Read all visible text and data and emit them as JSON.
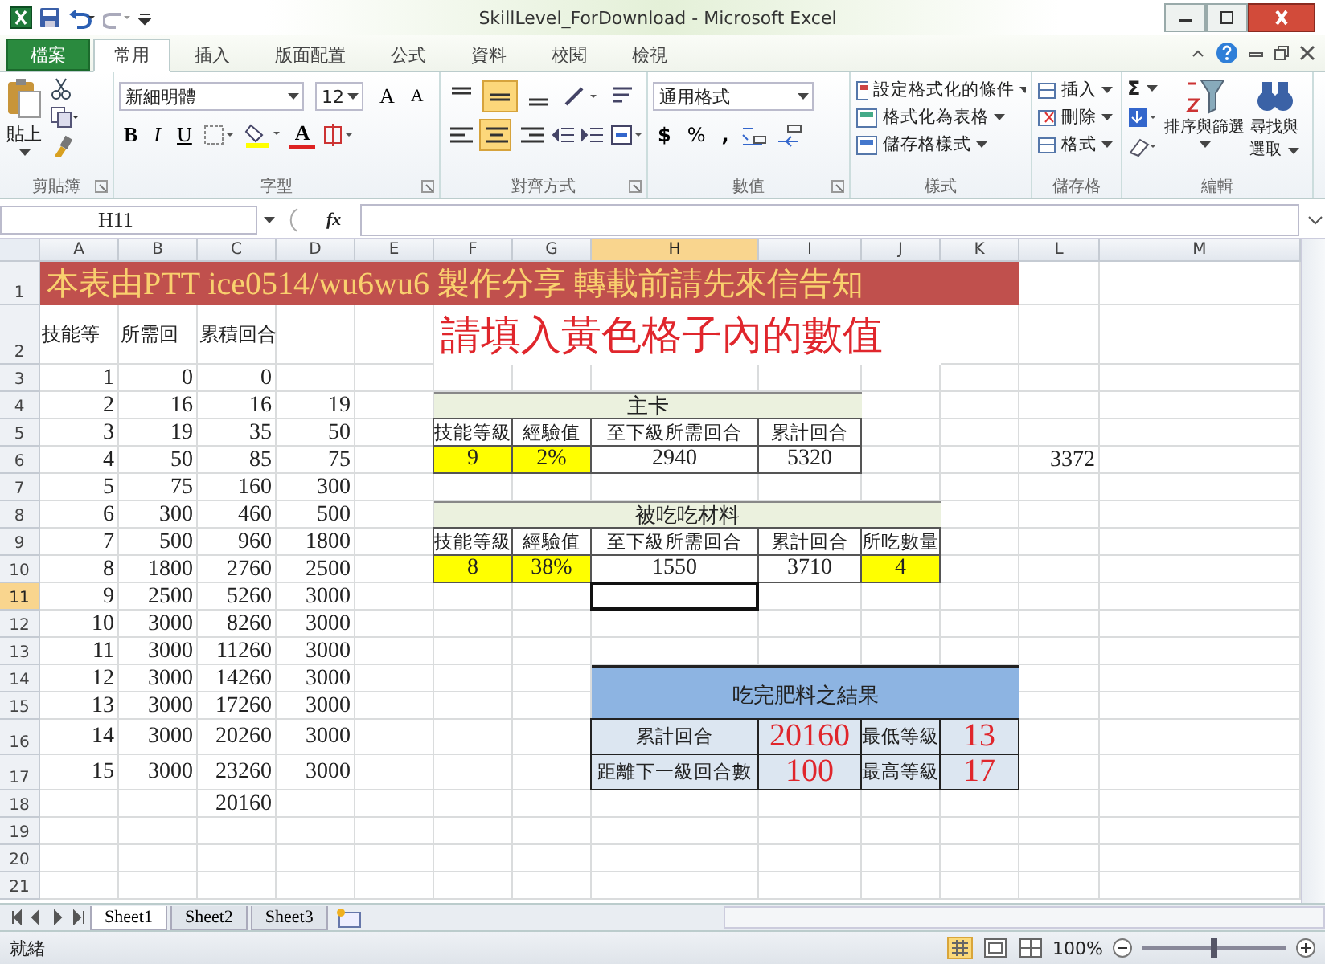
{
  "window": {
    "title": "SkillLevel_ForDownload - Microsoft Excel"
  },
  "tabs": [
    {
      "label": "檔案",
      "kind": "file",
      "selected": false
    },
    {
      "label": "常用",
      "kind": "tab",
      "selected": true
    },
    {
      "label": "插入",
      "kind": "tab",
      "selected": false
    },
    {
      "label": "版面配置",
      "kind": "tab",
      "selected": false
    },
    {
      "label": "公式",
      "kind": "tab",
      "selected": false
    },
    {
      "label": "資料",
      "kind": "tab",
      "selected": false
    },
    {
      "label": "校閱",
      "kind": "tab",
      "selected": false
    },
    {
      "label": "檢視",
      "kind": "tab",
      "selected": false
    }
  ],
  "ribbon": {
    "clipboard": {
      "label": "剪貼簿",
      "paste": "貼上"
    },
    "font": {
      "label": "字型",
      "font_name": "新細明體",
      "font_size": "12",
      "grow": "A",
      "shrink": "A",
      "bold": "B",
      "italic": "I",
      "underline": "U",
      "font_color": "A"
    },
    "alignment": {
      "label": "對齊方式",
      "vertical": [
        {
          "selected": false
        },
        {
          "selected": true
        },
        {
          "selected": false
        }
      ],
      "horizontal": [
        {
          "selected": false
        },
        {
          "selected": true
        },
        {
          "selected": false
        }
      ]
    },
    "number": {
      "label": "數值",
      "format": "通用格式",
      "currency": "$",
      "percent": "%",
      "comma": ","
    },
    "styles": {
      "label": "樣式",
      "items": [
        "設定格式化的條件",
        "格式化為表格",
        "儲存格樣式"
      ]
    },
    "cells": {
      "label": "儲存格",
      "items": [
        "插入",
        "刪除",
        "格式"
      ]
    },
    "editing": {
      "label": "編輯",
      "sum": "Σ",
      "sort": "排序與篩選",
      "find": "尋找與",
      "find_2": "選取"
    }
  },
  "formula_bar": {
    "name_box": "H11",
    "function_label": "fx"
  },
  "sheet": {
    "columns": [
      "A",
      "B",
      "C",
      "D",
      "E",
      "F",
      "G",
      "H",
      "I",
      "J",
      "K",
      "L",
      "M"
    ],
    "rows": [
      {
        "number": "1",
        "cells": [
          {
            "text": "本表由PTT ice0514/wu6wu6 製作分享 轉載前請先來信告知",
            "kind": "banner"
          },
          null,
          null,
          null,
          null,
          null,
          null,
          null,
          null,
          null,
          null
        ]
      },
      {
        "number": "2",
        "cells": [
          {
            "text": "技能等",
            "kind": "label"
          },
          {
            "text": "所需回",
            "kind": "label"
          },
          {
            "text": "累積回合",
            "kind": "label"
          },
          {},
          {},
          {
            "text": "請填入黃色格子內的數值",
            "kind": "note"
          },
          null,
          null,
          null,
          null
        ]
      },
      {
        "number": "3",
        "cells": [
          {
            "text": "1",
            "kind": "num"
          },
          {
            "text": "0",
            "kind": "num"
          },
          {
            "text": "0",
            "kind": "num"
          }
        ]
      },
      {
        "number": "4",
        "cells": [
          {
            "text": "2",
            "kind": "num"
          },
          {
            "text": "16",
            "kind": "num"
          },
          {
            "text": "16",
            "kind": "num"
          },
          {
            "text": "19",
            "kind": "num"
          },
          {},
          {
            "text": "主卡",
            "kind": "section"
          },
          null,
          null,
          null
        ]
      },
      {
        "number": "5",
        "cells": [
          {
            "text": "3",
            "kind": "num"
          },
          {
            "text": "19",
            "kind": "num"
          },
          {
            "text": "35",
            "kind": "num"
          },
          {
            "text": "50",
            "kind": "num"
          },
          {},
          {
            "text": "技能等級",
            "kind": "header"
          },
          {
            "text": "經驗值",
            "kind": "header"
          },
          {
            "text": "至下級所需回合",
            "kind": "header"
          },
          {
            "text": "累計回合",
            "kind": "header"
          }
        ]
      },
      {
        "number": "6",
        "cells": [
          {
            "text": "4",
            "kind": "num"
          },
          {
            "text": "50",
            "kind": "num"
          },
          {
            "text": "85",
            "kind": "num"
          },
          {
            "text": "75",
            "kind": "num"
          },
          {},
          {
            "text": "9",
            "kind": "input"
          },
          {
            "text": "2%",
            "kind": "input"
          },
          {
            "text": "2940",
            "kind": "value"
          },
          {
            "text": "5320",
            "kind": "value"
          },
          {},
          {},
          {
            "text": "3372",
            "kind": "num"
          }
        ]
      },
      {
        "number": "7",
        "cells": [
          {
            "text": "5",
            "kind": "num"
          },
          {
            "text": "75",
            "kind": "num"
          },
          {
            "text": "160",
            "kind": "num"
          },
          {
            "text": "300",
            "kind": "num"
          }
        ]
      },
      {
        "number": "8",
        "cells": [
          {
            "text": "6",
            "kind": "num"
          },
          {
            "text": "300",
            "kind": "num"
          },
          {
            "text": "460",
            "kind": "num"
          },
          {
            "text": "500",
            "kind": "num"
          },
          {},
          {
            "text": "被吃吃材料",
            "kind": "section"
          },
          null,
          null,
          null,
          null
        ]
      },
      {
        "number": "9",
        "cells": [
          {
            "text": "7",
            "kind": "num"
          },
          {
            "text": "500",
            "kind": "num"
          },
          {
            "text": "960",
            "kind": "num"
          },
          {
            "text": "1800",
            "kind": "num"
          },
          {},
          {
            "text": "技能等級",
            "kind": "header"
          },
          {
            "text": "經驗值",
            "kind": "header"
          },
          {
            "text": "至下級所需回合",
            "kind": "header"
          },
          {
            "text": "累計回合",
            "kind": "header"
          },
          {
            "text": "所吃數量",
            "kind": "header"
          }
        ]
      },
      {
        "number": "10",
        "cells": [
          {
            "text": "8",
            "kind": "num"
          },
          {
            "text": "1800",
            "kind": "num"
          },
          {
            "text": "2760",
            "kind": "num"
          },
          {
            "text": "2500",
            "kind": "num"
          },
          {},
          {
            "text": "8",
            "kind": "input"
          },
          {
            "text": "38%",
            "kind": "input"
          },
          {
            "text": "1550",
            "kind": "value"
          },
          {
            "text": "3710",
            "kind": "value"
          },
          {
            "text": "4",
            "kind": "input"
          }
        ]
      },
      {
        "number": "11",
        "cells": [
          {
            "text": "9",
            "kind": "num"
          },
          {
            "text": "2500",
            "kind": "num"
          },
          {
            "text": "5260",
            "kind": "num"
          },
          {
            "text": "3000",
            "kind": "num"
          },
          {},
          {},
          {},
          {
            "selected": true
          }
        ]
      },
      {
        "number": "12",
        "cells": [
          {
            "text": "10",
            "kind": "num"
          },
          {
            "text": "3000",
            "kind": "num"
          },
          {
            "text": "8260",
            "kind": "num"
          },
          {
            "text": "3000",
            "kind": "num"
          }
        ]
      },
      {
        "number": "13",
        "cells": [
          {
            "text": "11",
            "kind": "num"
          },
          {
            "text": "3000",
            "kind": "num"
          },
          {
            "text": "11260",
            "kind": "num"
          },
          {
            "text": "3000",
            "kind": "num"
          }
        ]
      },
      {
        "number": "14",
        "cells": [
          {
            "text": "12",
            "kind": "num"
          },
          {
            "text": "3000",
            "kind": "num"
          },
          {
            "text": "14260",
            "kind": "num"
          },
          {
            "text": "3000",
            "kind": "num"
          }
        ]
      },
      {
        "number": "15",
        "cells": [
          {
            "text": "13",
            "kind": "num"
          },
          {
            "text": "3000",
            "kind": "num"
          },
          {
            "text": "17260",
            "kind": "num"
          },
          {
            "text": "3000",
            "kind": "num"
          },
          {},
          {},
          {},
          {
            "text": "吃完肥料之結果",
            "kind": "result-head"
          },
          null,
          null,
          null
        ]
      },
      {
        "number": "16",
        "cells": [
          {
            "text": "14",
            "kind": "num"
          },
          {
            "text": "3000",
            "kind": "num"
          },
          {
            "text": "20260",
            "kind": "num"
          },
          {
            "text": "3000",
            "kind": "num"
          },
          {},
          {},
          {},
          {
            "text": "累計回合",
            "kind": "result-label"
          },
          {
            "text": "20160",
            "kind": "result-value"
          },
          {
            "text": "最低等級",
            "kind": "result-label"
          },
          {
            "text": "13",
            "kind": "result-value"
          }
        ]
      },
      {
        "number": "17",
        "cells": [
          {
            "text": "15",
            "kind": "num"
          },
          {
            "text": "3000",
            "kind": "num"
          },
          {
            "text": "23260",
            "kind": "num"
          },
          {
            "text": "3000",
            "kind": "num"
          },
          {},
          {},
          {},
          {
            "text": "距離下一級回合數",
            "kind": "result-label"
          },
          {
            "text": "100",
            "kind": "result-value"
          },
          {
            "text": "最高等級",
            "kind": "result-label"
          },
          {
            "text": "17",
            "kind": "result-value"
          }
        ]
      },
      {
        "number": "18",
        "cells": [
          {},
          {},
          {
            "text": "20160",
            "kind": "num"
          }
        ]
      },
      {
        "number": "19",
        "cells": []
      },
      {
        "number": "20",
        "cells": []
      },
      {
        "number": "21",
        "cells": []
      }
    ]
  },
  "sheet_tabs": [
    {
      "label": "Sheet1",
      "selected": true
    },
    {
      "label": "Sheet2",
      "selected": false
    },
    {
      "label": "Sheet3",
      "selected": false
    }
  ],
  "status_bar": {
    "status": "就緒",
    "zoom": "100%",
    "zoom_slider": {
      "level": 0.5
    }
  }
}
